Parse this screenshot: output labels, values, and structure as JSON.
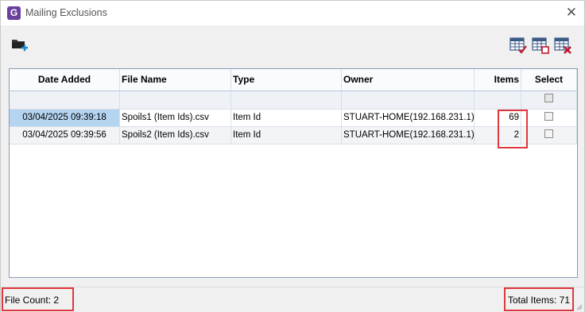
{
  "window": {
    "title": "Mailing Exclusions",
    "app_icon_letter": "G",
    "close_glyph": "✕"
  },
  "toolbar": {
    "left_icon": "add-folder-icon",
    "right_icons": [
      "select-all-grid-icon",
      "deselect-grid-icon",
      "delete-grid-icon"
    ]
  },
  "grid": {
    "columns": [
      "Date Added",
      "File Name",
      "Type",
      "Owner",
      "Items",
      "Select"
    ],
    "rows": [
      {
        "date_added": "03/04/2025 09:39:18",
        "file_name": "Spoils1 (Item Ids).csv",
        "type": "Item Id",
        "owner": "STUART-HOME(192.168.231.1)",
        "items": "69",
        "selected": false
      },
      {
        "date_added": "03/04/2025 09:39:56",
        "file_name": "Spoils2 (Item Ids).csv",
        "type": "Item Id",
        "owner": "STUART-HOME(192.168.231.1)",
        "items": "2",
        "selected": false
      }
    ]
  },
  "status": {
    "file_count": "File Count: 2",
    "total_items": "Total Items: 71"
  },
  "colors": {
    "highlight_border": "#e0383e",
    "selected_cell": "#b5d4f0",
    "app_icon": "#6a3f9e"
  }
}
